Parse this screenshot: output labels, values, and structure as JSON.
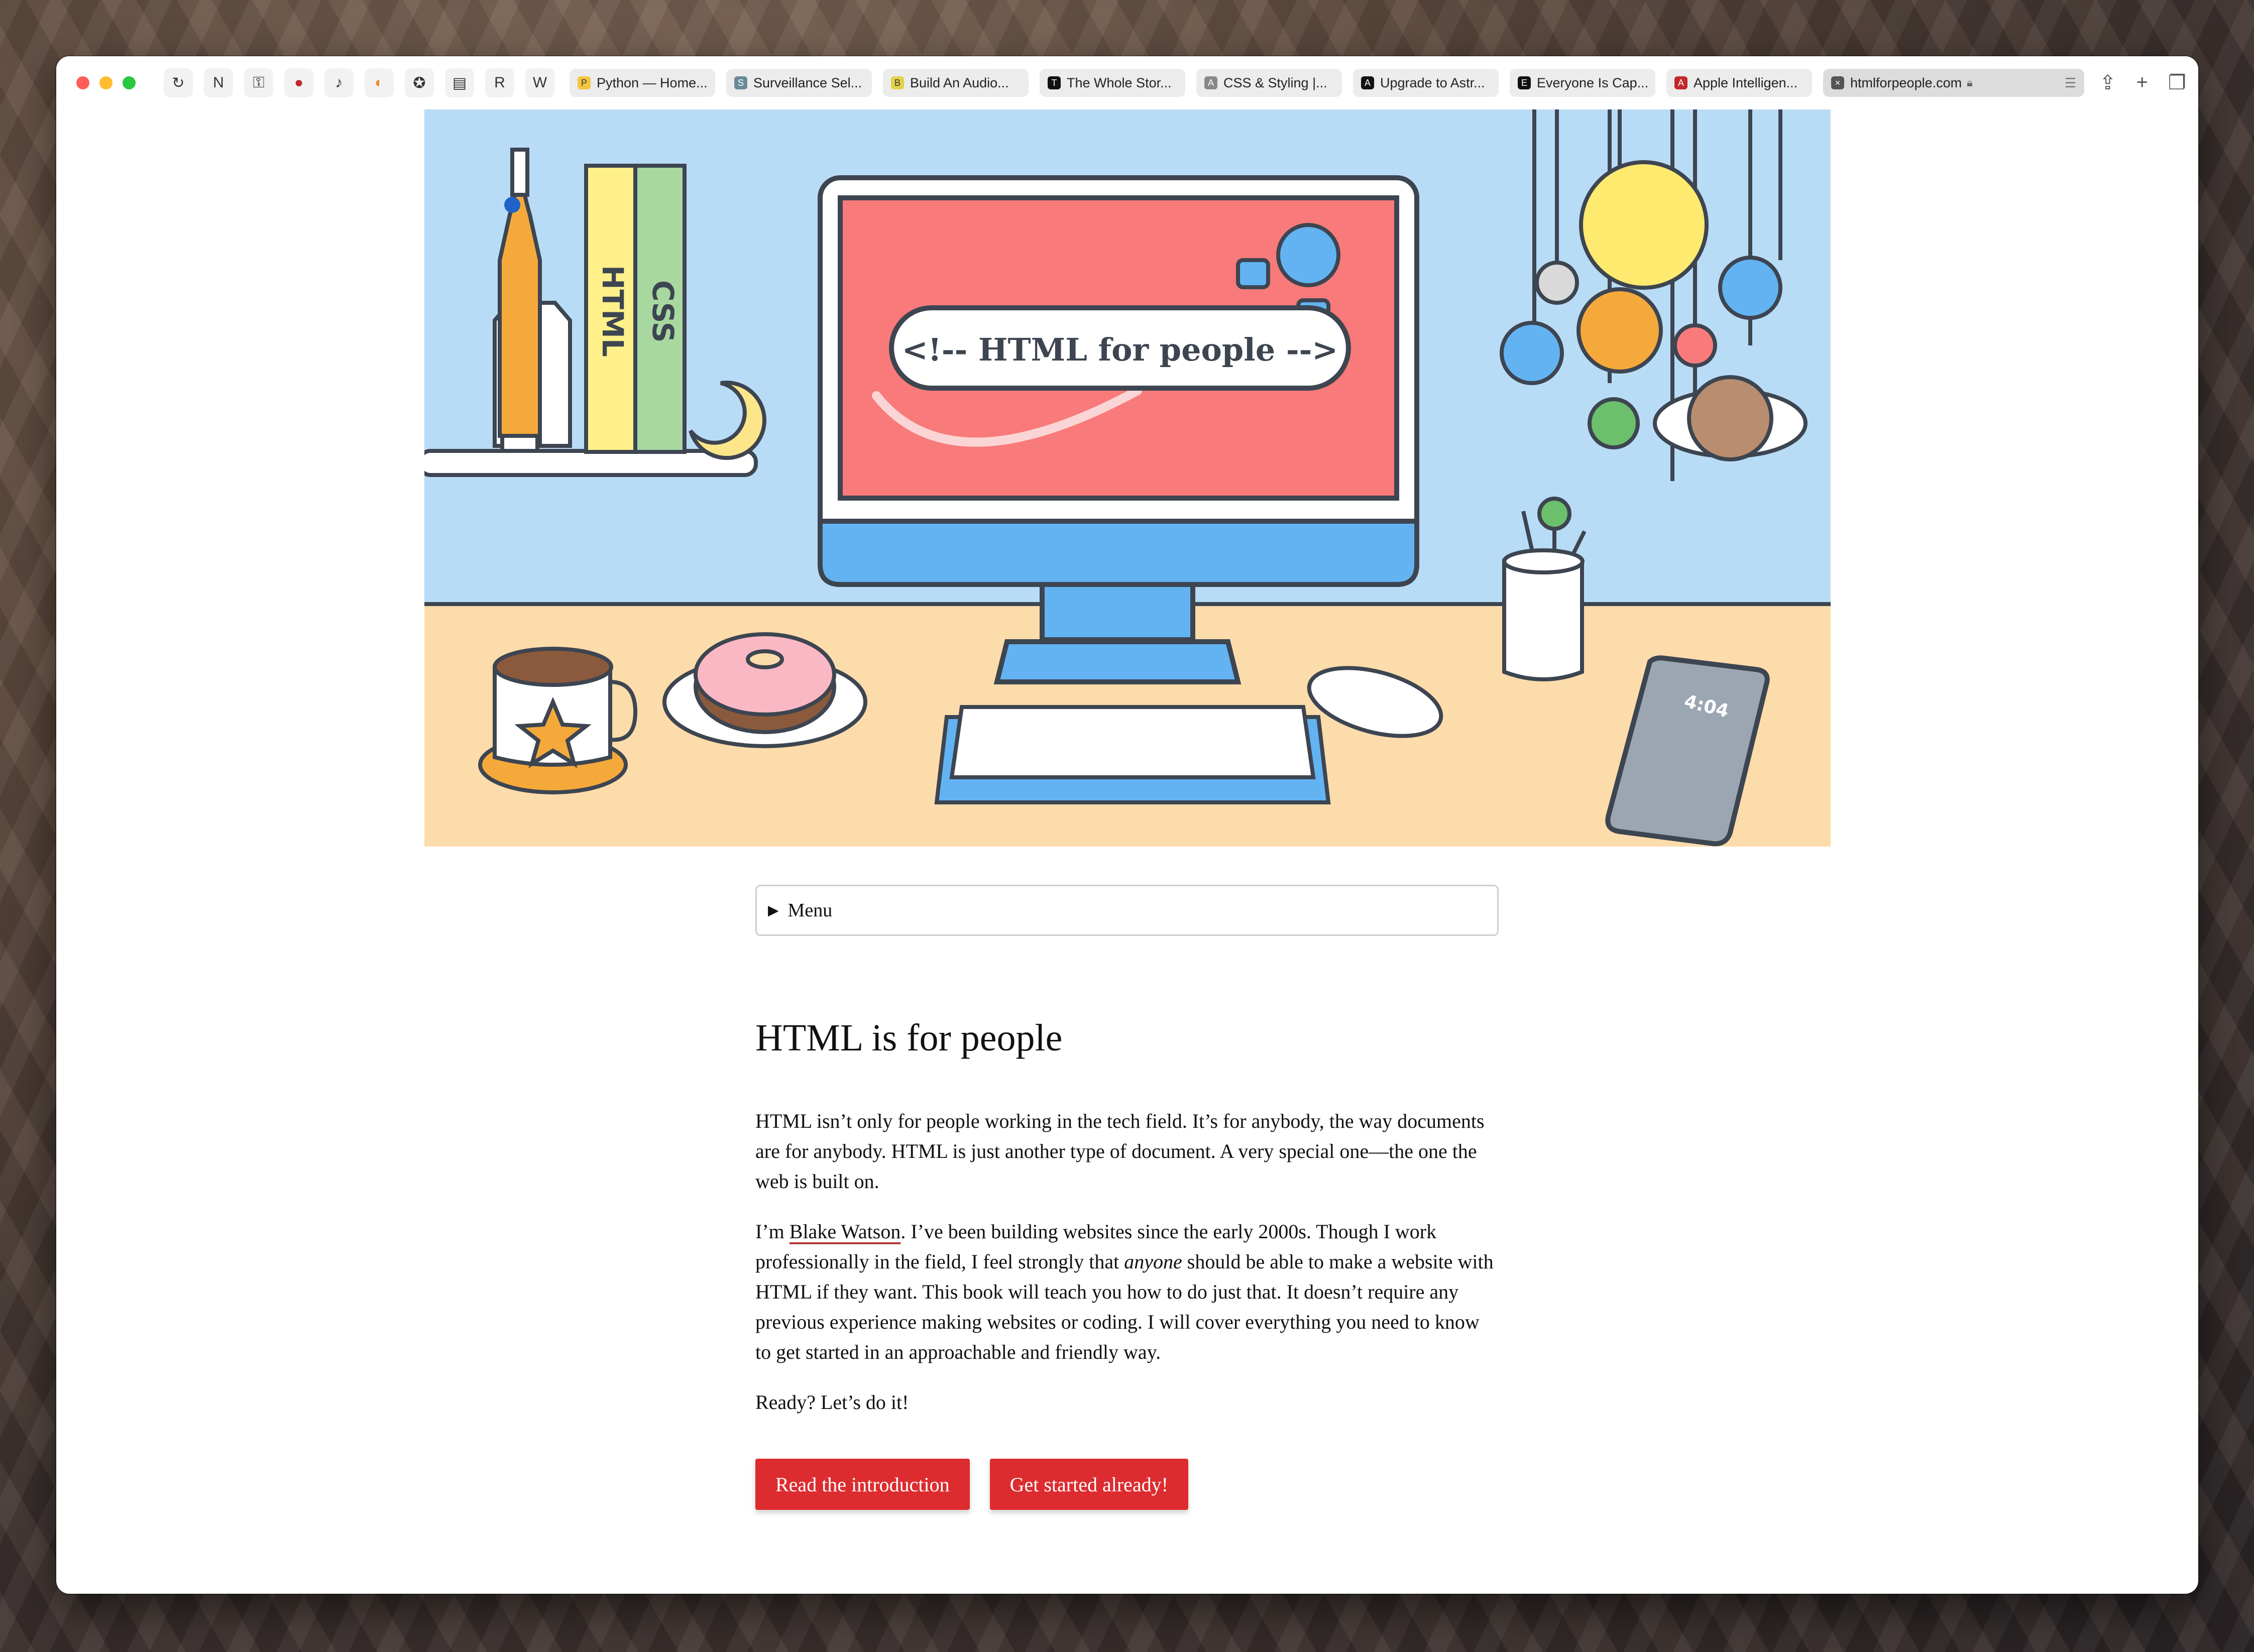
{
  "browser": {
    "pinned_tabs": [
      {
        "icon": "refresh-icon",
        "glyph": "↻"
      },
      {
        "icon": "notion-icon",
        "glyph": "N"
      },
      {
        "icon": "password-icon",
        "glyph": "⚿"
      },
      {
        "icon": "record-icon",
        "glyph": "●"
      },
      {
        "icon": "podcast-icon",
        "glyph": "♪"
      },
      {
        "icon": "color-icon",
        "glyph": "◐"
      },
      {
        "icon": "star-icon",
        "glyph": "✪"
      },
      {
        "icon": "news-icon",
        "glyph": "▤"
      },
      {
        "icon": "r-icon",
        "glyph": "R"
      },
      {
        "icon": "w-icon",
        "glyph": "W"
      }
    ],
    "tabs": [
      {
        "title": "Python — Home...",
        "fav": "P"
      },
      {
        "title": "Surveillance Sel...",
        "fav": "S"
      },
      {
        "title": "Build An Audio...",
        "fav": "B"
      },
      {
        "title": "The Whole Stor...",
        "fav": "T"
      },
      {
        "title": "CSS & Styling |...",
        "fav": "A"
      },
      {
        "title": "Upgrade to Astr...",
        "fav": "A"
      },
      {
        "title": "Everyone Is Cap...",
        "fav": "E"
      },
      {
        "title": "Apple Intelligen...",
        "fav": "A"
      }
    ],
    "active_tab": {
      "title": "htmlforpeople.com",
      "fav": "×"
    }
  },
  "hero": {
    "banner_text": "<!-- HTML for people -->",
    "book1": "HTML",
    "book2": "CSS",
    "phone_time": "4:04"
  },
  "menu": {
    "label": "Menu"
  },
  "page": {
    "heading": "HTML is for people",
    "p1": "HTML isn’t only for people working in the tech field. It’s for anybody, the way documents are for anybody. HTML is just another type of document. A very special one—the one the web is built on.",
    "p2_before": "I’m ",
    "p2_link": "Blake Watson",
    "p2_mid": ". I’ve been building websites since the early 2000s. Though I work professionally in the field, I feel strongly that ",
    "p2_em": "anyone",
    "p2_after": " should be able to make a website with HTML if they want. This book will teach you how to do just that. It doesn’t require any previous experience making websites or coding. I will cover everything you need to know to get started in an approachable and friendly way.",
    "p3": "Ready? Let’s do it!",
    "btn_intro": "Read the introduction",
    "btn_start": "Get started already!"
  },
  "colors": {
    "accent": "#dd2c2f",
    "wall": "#b9dcf6",
    "desk": "#fddcab",
    "screen": "#f87a7a"
  }
}
